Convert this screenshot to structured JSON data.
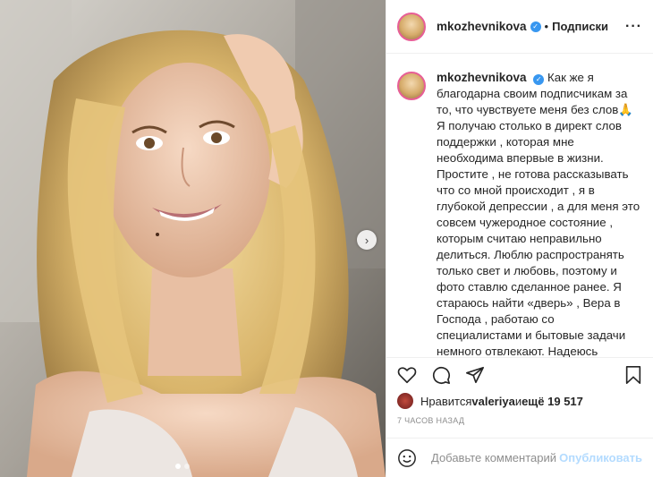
{
  "post": {
    "username": "mkozhevnikova",
    "verified_icon": "verified-badge-icon",
    "follow_separator": "•",
    "follow_label": "Подписки",
    "more_icon": "more-options-icon",
    "caption": "Как же я благодарна своим подписчикам за то, что чувствуете меня без слов🙏 Я получаю столько в директ слов поддержки , которая мне необходима впервые в жизни. Простите , не готова рассказывать что со мной происходит , я в глубокой депрессии , а для меня это совсем чужеродное состояние , которым считаю неправильно делиться. Люблю распространять только свет и любовь, поэтому и фото ставлю сделанное ранее. Я стараюсь найти «дверь» , Вера в Господа , работаю со специалистами и бытовые задачи немного отвлекают. Надеюсь справлюсь и найду выход, если не можешь",
    "likes_prefix": "Нравится ",
    "likes_user": "valeriya",
    "likes_middle": " и ",
    "likes_count": "ещё 19 517",
    "timestamp": "7 ЧАСОВ НАЗАД"
  },
  "actions": {
    "like_icon": "heart-icon",
    "comment_icon": "comment-icon",
    "share_icon": "share-icon",
    "save_icon": "bookmark-icon"
  },
  "comment": {
    "emoji_icon": "emoji-icon",
    "placeholder": "Добавьте комментарий...",
    "publish_label": "Опубликовать"
  },
  "media": {
    "carousel_next_icon": "chevron-right-icon",
    "carousel_next_glyph": "›",
    "slide_total": 2,
    "slide_active": 1
  },
  "colors": {
    "accent_blue": "#3897f0",
    "publish_disabled": "#b3dbff",
    "story_ring": "#e75e96",
    "meta_gray": "#8e8e8e"
  }
}
